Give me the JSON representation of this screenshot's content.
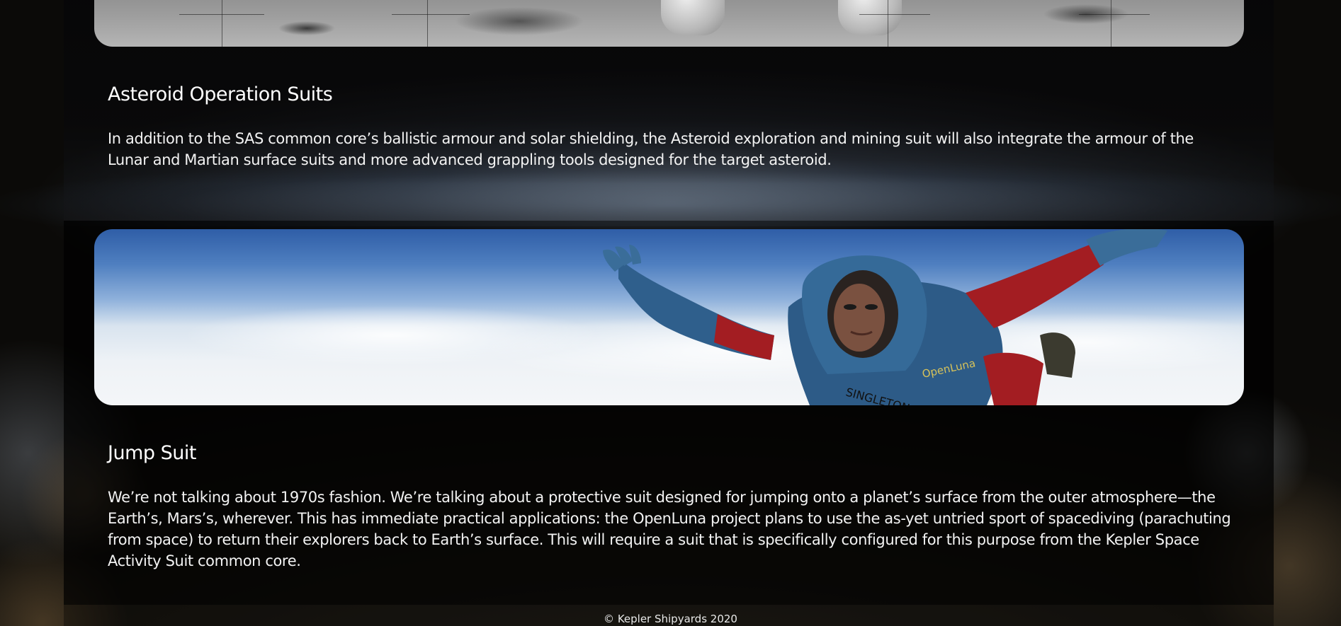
{
  "sections": [
    {
      "heading": "Asteroid Operation Suits",
      "body": "In addition to the SAS common core’s ballistic armour and solar shielding, the Asteroid exploration and mining suit will also integrate the armour of the Lunar and Martian surface suits and more advanced grappling tools designed for the target asteroid."
    },
    {
      "heading": "Jump Suit",
      "body": "We’re not talking about 1970s fashion. We’re talking about a protective suit designed for jumping onto a planet’s surface from the outer atmosphere—the Earth’s, Mars’s, wherever. This has immediate practical applications: the OpenLuna project plans to use the as-yet untried sport of spacediving (parachuting from space) to return their explorers back to Earth’s surface. This will require a suit that is specifically configured for this purpose from the Kepler Space Activity Suit common core."
    }
  ],
  "images": {
    "moon_banner": "moon-surface-boots-image",
    "sky_banner": "spacediver-jump-suit-image",
    "suit_labels": [
      "SINGLETON",
      "OpenLuna"
    ]
  },
  "footer": {
    "copyright": "© Kepler Shipyards 2020"
  },
  "colors": {
    "page_background": "#0b0a08",
    "panel_overlay": "rgba(0,0,0,0.72)",
    "text": "#f3f3f3",
    "suit_blue": "#2f5f8c",
    "suit_red": "#a31d22"
  }
}
